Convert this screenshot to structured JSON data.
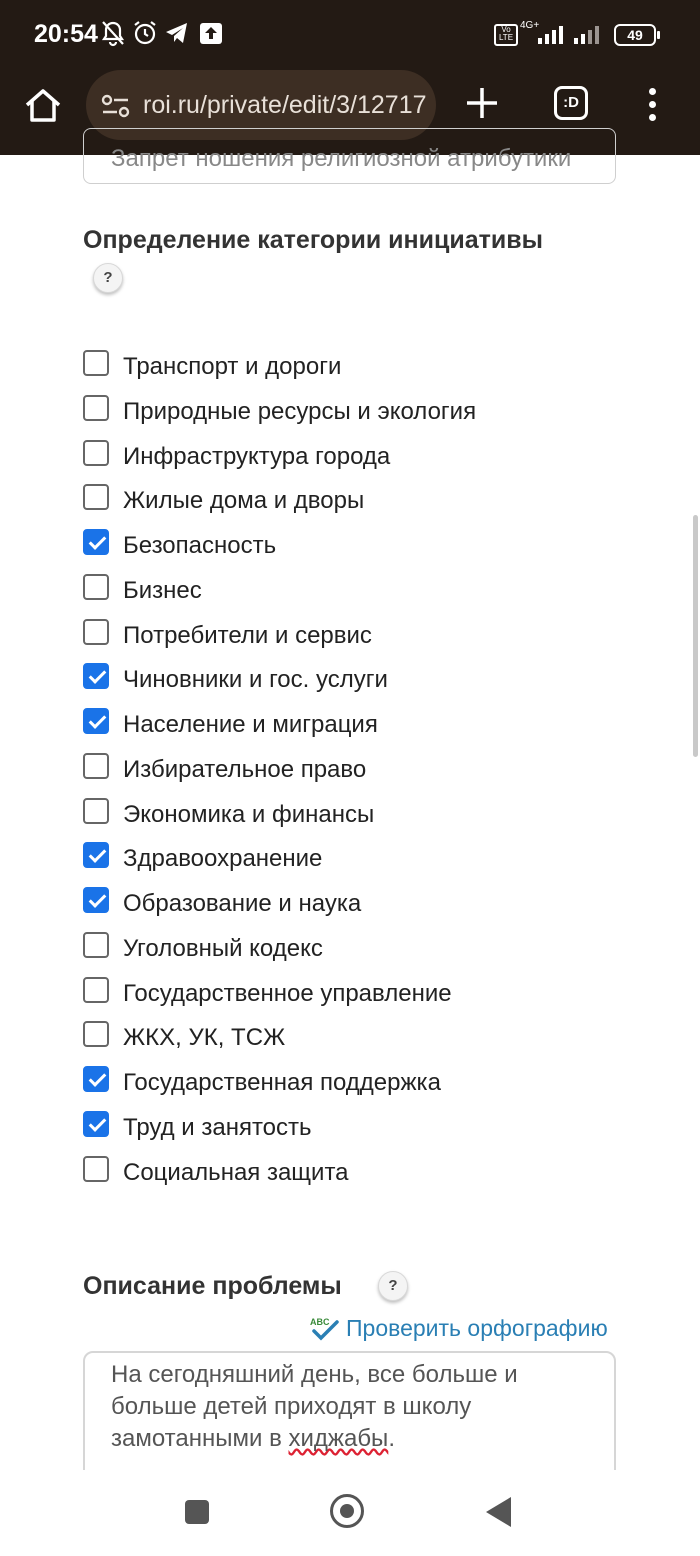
{
  "status_bar": {
    "time": "20:54",
    "network_badge": "Vo LTE",
    "network_type": "4G+",
    "battery": "49"
  },
  "browser": {
    "url": "roi.ru/private/edit/3/12717",
    "tabs_label": ":D"
  },
  "form": {
    "previous_field_value": "Запрет ношения религиозной атрибутики",
    "category_section": {
      "title": "Определение категории инициативы",
      "help": "?",
      "categories": [
        {
          "label": "Транспорт и дороги",
          "checked": false
        },
        {
          "label": "Природные ресурсы и экология",
          "checked": false
        },
        {
          "label": "Инфраструктура города",
          "checked": false
        },
        {
          "label": "Жилые дома и дворы",
          "checked": false
        },
        {
          "label": "Безопасность",
          "checked": true
        },
        {
          "label": "Бизнес",
          "checked": false
        },
        {
          "label": "Потребители и сервис",
          "checked": false
        },
        {
          "label": "Чиновники и гос. услуги",
          "checked": true
        },
        {
          "label": "Население и миграция",
          "checked": true
        },
        {
          "label": "Избирательное право",
          "checked": false
        },
        {
          "label": "Экономика и финансы",
          "checked": false
        },
        {
          "label": "Здравоохранение",
          "checked": true
        },
        {
          "label": "Образование и наука",
          "checked": true
        },
        {
          "label": "Уголовный кодекс",
          "checked": false
        },
        {
          "label": "Государственное управление",
          "checked": false
        },
        {
          "label": "ЖКХ, УК, ТСЖ",
          "checked": false
        },
        {
          "label": "Государственная поддержка",
          "checked": true
        },
        {
          "label": "Труд и занятость",
          "checked": true
        },
        {
          "label": "Социальная защита",
          "checked": false
        }
      ]
    },
    "description_section": {
      "title": "Описание проблемы",
      "help": "?",
      "spellcheck_label": "Проверить орфографию",
      "text_line1": "На сегодняшний день, все больше и",
      "text_line2": "больше детей приходят в школу",
      "text_line3_start": "замотанными в ",
      "text_line3_misspelled": "хиджабы",
      "text_line3_end": "."
    }
  },
  "colors": {
    "chrome_bg": "#231a14",
    "urlbar_bg": "#3d2e23",
    "checkbox_checked": "#1a73e8",
    "link": "#2a7fb4"
  }
}
